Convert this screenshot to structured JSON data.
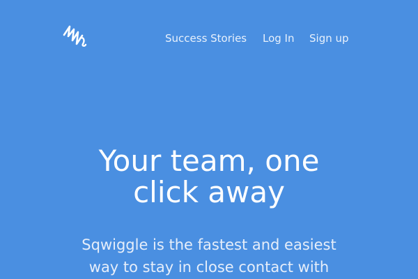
{
  "header": {
    "logo_icon": "squiggle-logo-icon",
    "nav": {
      "success_stories": "Success Stories",
      "log_in": "Log In",
      "sign_up": "Sign up"
    }
  },
  "hero": {
    "title_line1": "Your team, one",
    "title_line2": "click away",
    "subtitle_line1": "Sqwiggle is the fastest and easiest",
    "subtitle_line2": "way to stay in close contact with"
  },
  "colors": {
    "background": "#4a8fe1",
    "text": "#ffffff"
  }
}
